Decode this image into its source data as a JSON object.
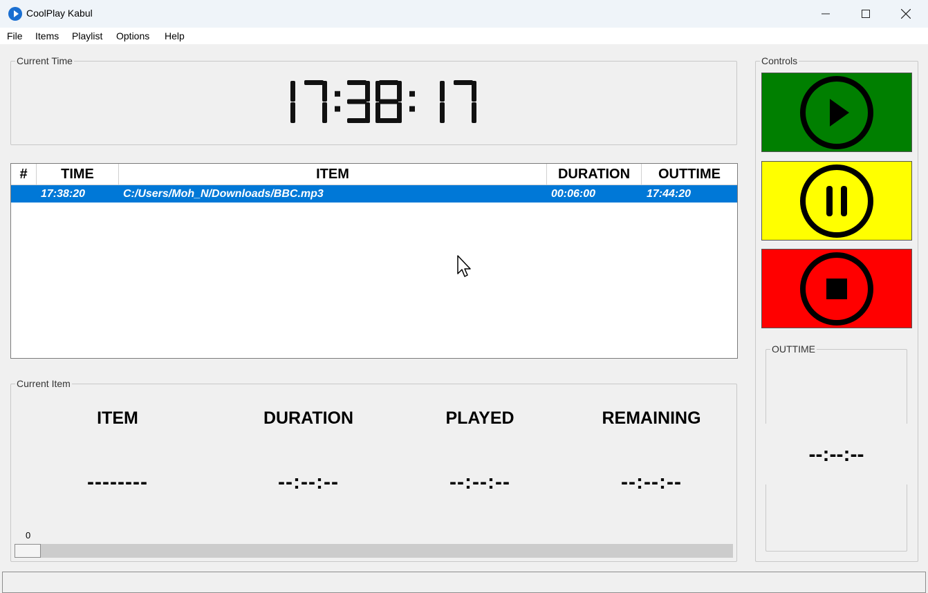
{
  "window": {
    "title": "CoolPlay Kabul",
    "minimize_label": "Minimize",
    "maximize_label": "Maximize",
    "close_label": "Close"
  },
  "menu": [
    "File",
    "Items",
    "Playlist",
    "Options",
    "Help"
  ],
  "current_time": {
    "legend": "Current Time",
    "value": "17:38:17"
  },
  "playlist": {
    "columns": [
      "#",
      "TIME",
      "ITEM",
      "DURATION",
      "OUTTIME"
    ],
    "rows": [
      {
        "index": "",
        "time": "17:38:20",
        "item": "C:/Users/Moh_N/Downloads/BBC.mp3",
        "duration": "00:06:00",
        "outtime": "17:44:20",
        "selected": true
      }
    ]
  },
  "current_item": {
    "legend": "Current Item",
    "labels": {
      "item": "ITEM",
      "duration": "DURATION",
      "played": "PLAYED",
      "remaining": "REMAINING"
    },
    "values": {
      "item": "--------",
      "duration": "--:--:--",
      "played": "--:--:--",
      "remaining": "--:--:--"
    },
    "slider_min_label": "0",
    "slider_value": 0
  },
  "controls": {
    "legend": "Controls",
    "play_color": "#007f00",
    "pause_color": "#ffff00",
    "stop_color": "#ff0000",
    "icons": [
      "play-icon",
      "pause-icon",
      "stop-icon"
    ]
  },
  "outtime": {
    "legend": "OUTTIME",
    "value": "--:--:--"
  }
}
